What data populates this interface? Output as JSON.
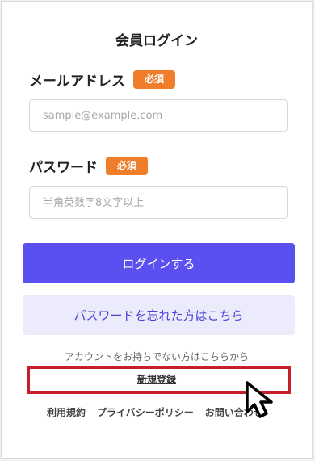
{
  "form": {
    "title": "会員ログイン",
    "required_badge": "必須",
    "email_label": "メールアドレス",
    "email_placeholder": "sample@example.com",
    "email_value": "",
    "password_label": "パスワード",
    "password_placeholder": "半角英数字8文字以上",
    "password_value": "",
    "login_button": "ログインする",
    "forgot_button": "パスワードを忘れた方はこちら",
    "no_account_text": "アカウントをお持ちでない方はこちらから",
    "register_link": "新規登録"
  },
  "footer": {
    "links": [
      "利用規約",
      "プライバシーポリシー",
      "お問い合わせ"
    ]
  },
  "colors": {
    "accent": "#5a50f0",
    "badge": "#f07d2a",
    "highlight": "#c81e2a",
    "secondary_bg": "#ecebfb"
  },
  "icons": {
    "cursor": "mouse-pointer-icon"
  }
}
